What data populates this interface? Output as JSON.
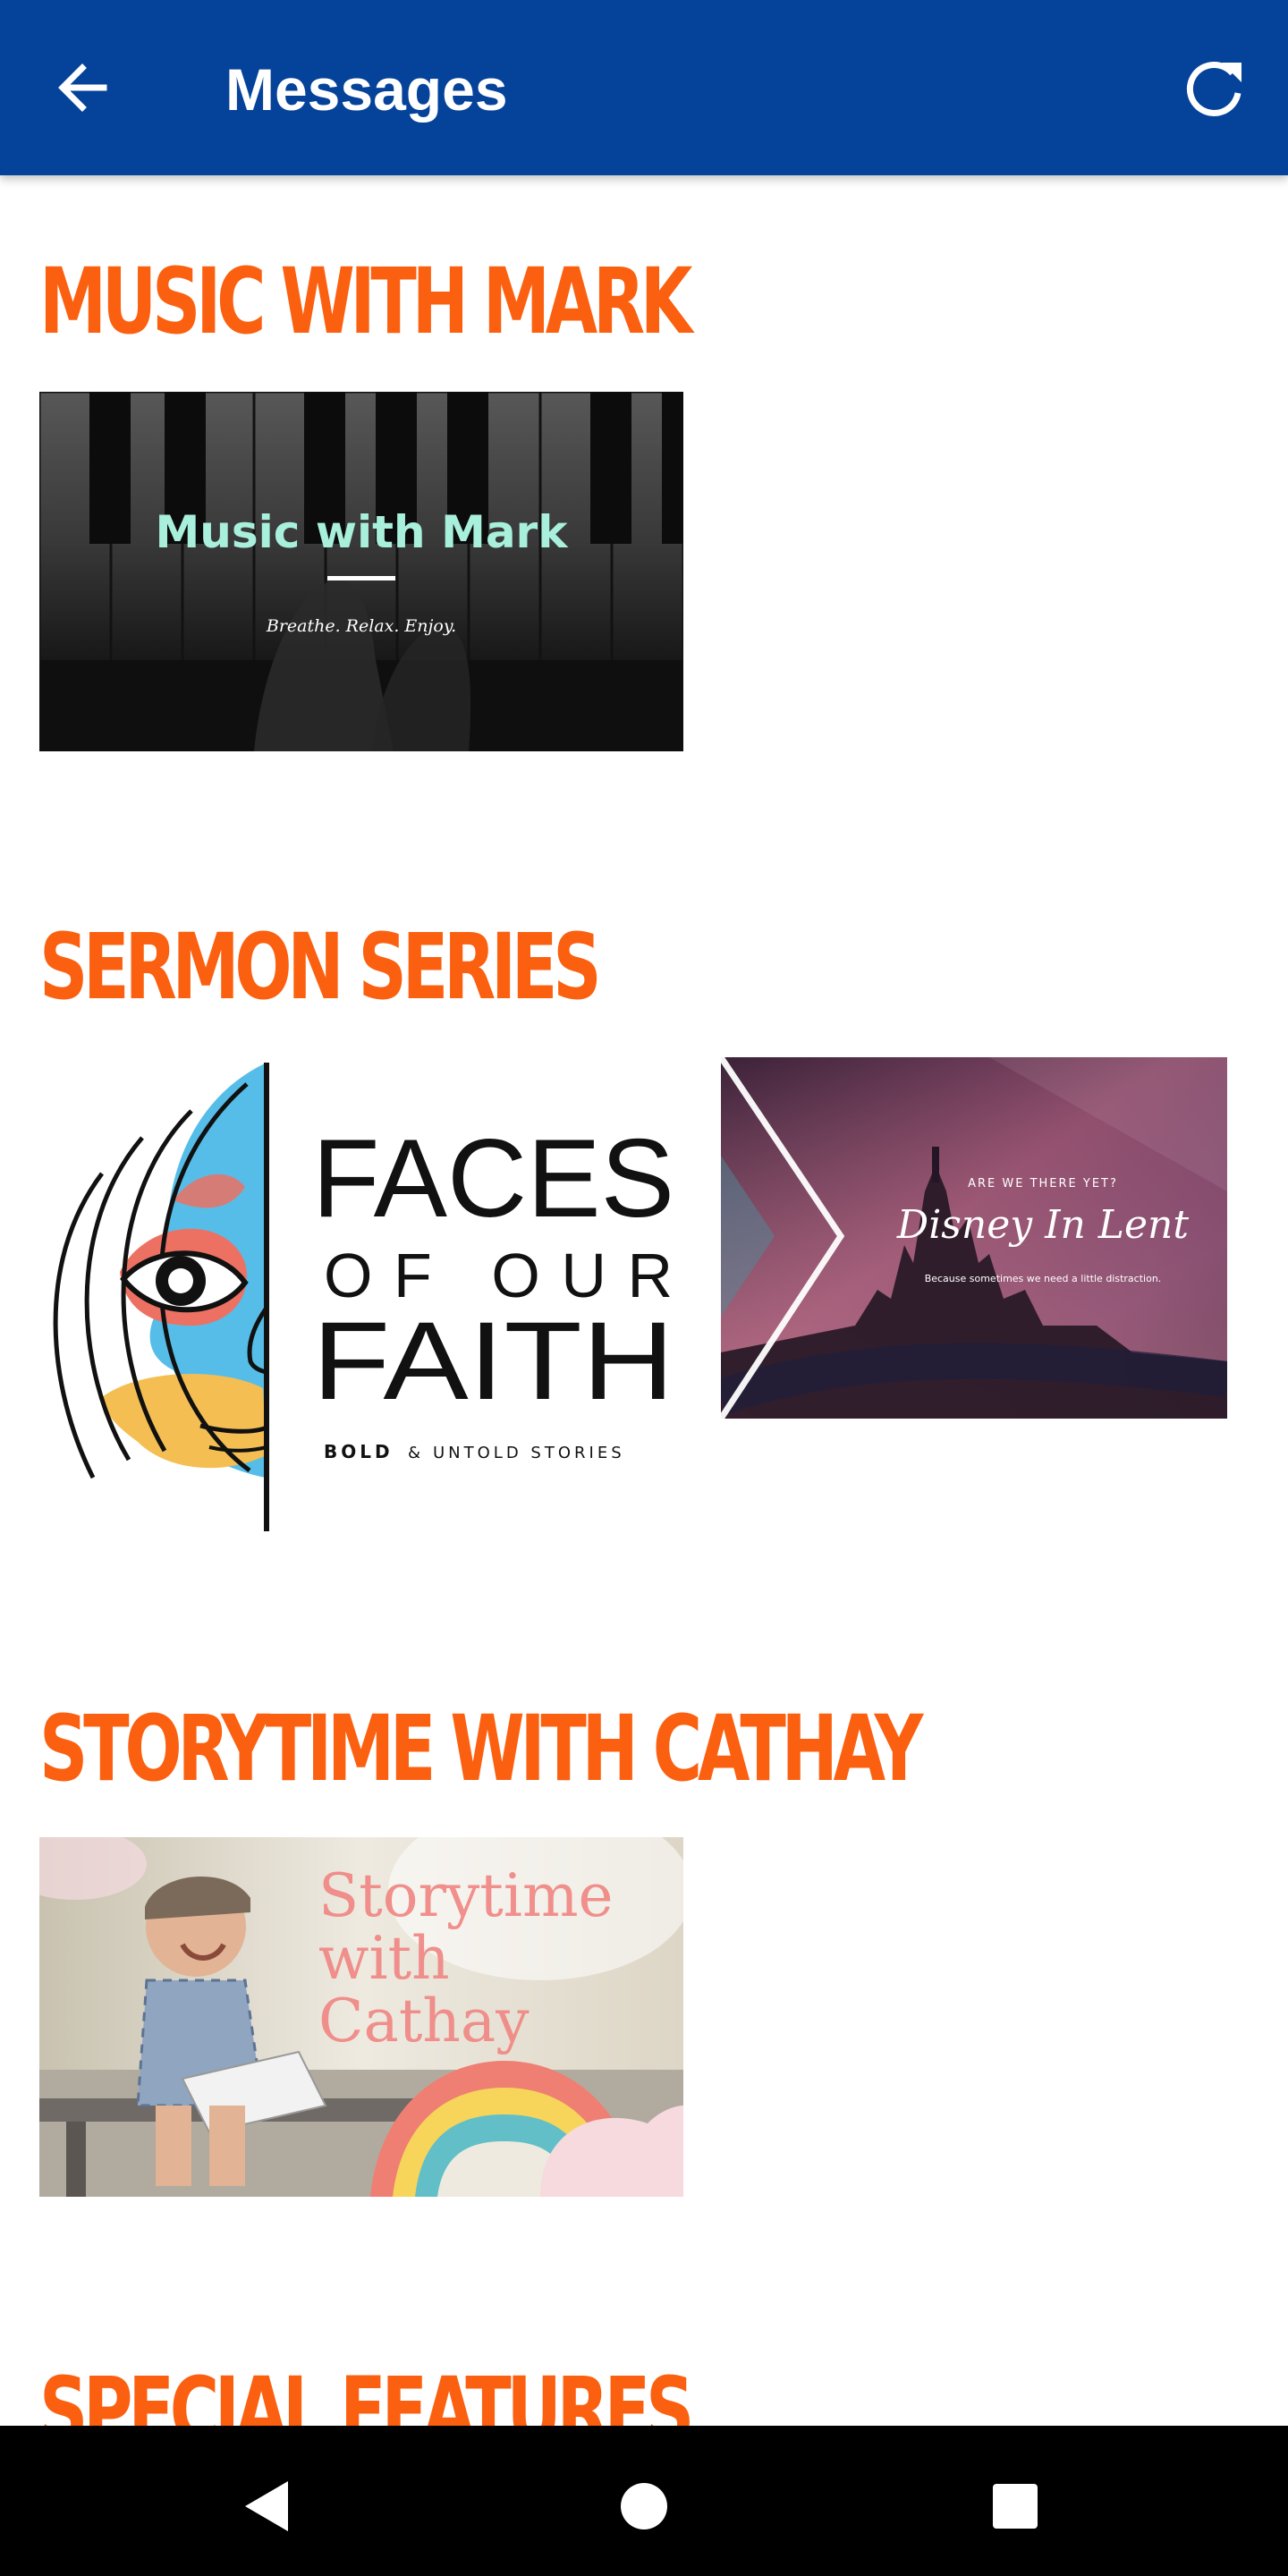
{
  "appbar": {
    "title": "Messages",
    "back_icon": "arrow-left-icon",
    "refresh_icon": "refresh-icon",
    "background": "#05429a"
  },
  "sections": [
    {
      "title": "MUSIC WITH MARK",
      "items": [
        {
          "title": "Music with Mark",
          "subtitle": "Breathe. Relax. Enjoy."
        }
      ]
    },
    {
      "title": "SERMON SERIES",
      "items": [
        {
          "line1": "FACES",
          "line2": "OF OUR",
          "line3": "FAITH",
          "tagline_bold": "BOLD",
          "tagline_amp": "&",
          "tagline_rest": "UNTOLD STORIES"
        },
        {
          "kicker": "ARE WE THERE YET?",
          "title": "Disney In Lent",
          "subtitle": "Because sometimes we need a little distraction."
        }
      ]
    },
    {
      "title": "STORYTIME WITH CATHAY",
      "items": [
        {
          "line1": "Storytime",
          "line2": "with",
          "line3": "Cathay"
        }
      ]
    },
    {
      "title": "SPECIAL FEATURES",
      "items": []
    }
  ],
  "colors": {
    "section_title": "#fb6010",
    "music_title": "#a8f0dc",
    "storytime_text": "#f08a86"
  },
  "navbar": {
    "back_icon": "triangle-back-icon",
    "home_icon": "circle-home-icon",
    "recents_icon": "square-recents-icon"
  }
}
